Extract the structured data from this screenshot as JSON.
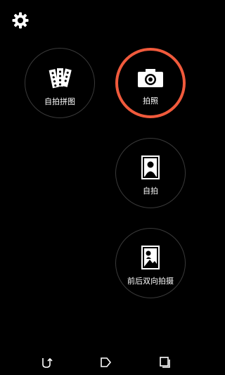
{
  "colors": {
    "accent": "#f05a3c",
    "ring": "#3a3a3a",
    "background": "#000000"
  },
  "top_bar": {
    "settings_icon": "gear-icon"
  },
  "modes": [
    {
      "id": "collage",
      "label": "自拍拼图",
      "icon": "collage-icon",
      "selected": false
    },
    {
      "id": "photo",
      "label": "拍照",
      "icon": "camera-icon",
      "selected": true
    },
    {
      "id": "selfie",
      "label": "自拍",
      "icon": "portrait-icon",
      "selected": false
    },
    {
      "id": "dual",
      "label": "前后双向拍摄",
      "icon": "dual-capture-icon",
      "selected": false
    }
  ],
  "nav_bar": {
    "back": "back-icon",
    "home": "home-icon",
    "recents": "recents-icon"
  }
}
